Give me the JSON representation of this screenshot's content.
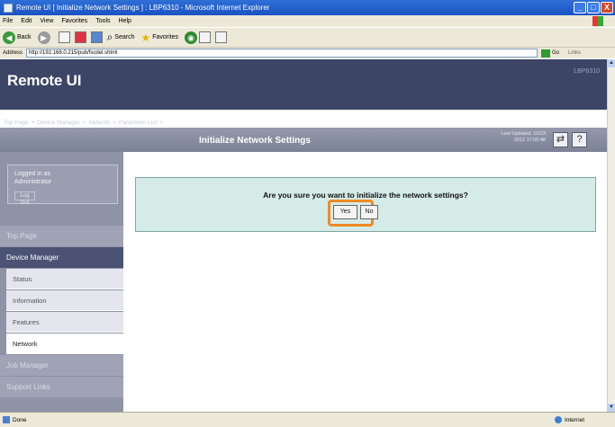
{
  "window": {
    "title": "Remote UI [ Initialize Network Settings ] : LBP6310 - Microsoft Internet Explorer",
    "minimize": "_",
    "maximize": "□",
    "close": "X"
  },
  "menu": [
    "File",
    "Edit",
    "View",
    "Favorites",
    "Tools",
    "Help"
  ],
  "toolbar": {
    "back": "Back",
    "search": "Search",
    "favorites": "Favorites"
  },
  "address": {
    "label": "Address",
    "url": "http://192.168.0.215/pub/fscdel.shtml",
    "go": "Go",
    "links": "Links"
  },
  "brand": {
    "name": "Remote UI",
    "model": "LBP6310"
  },
  "breadcrumb": {
    "items": [
      "Top Page",
      "Device Manager",
      "Network",
      "Parameter List"
    ],
    "current": "Initialize Network Settings"
  },
  "header": {
    "title": "Initialize Network Settings",
    "last_updated": "Last Updated: 10/23 2012 17:05:48",
    "refresh": "⇄",
    "help": "?"
  },
  "login": {
    "text": "Logged in as\nAdministrator",
    "logout": "Log Out"
  },
  "nav": {
    "top_page": "Top Page",
    "device_manager": "Device Manager",
    "status": "Status",
    "information": "Information",
    "features": "Features",
    "network": "Network",
    "job_manager": "Job Manager",
    "support_links": "Support Links"
  },
  "dialog": {
    "message": "Are you sure you want to initialize the network settings?",
    "yes": "Yes",
    "no": "No",
    "highlight_color": "#ef8a24"
  },
  "statusbar": {
    "status": "Done",
    "zone": "Internet"
  }
}
